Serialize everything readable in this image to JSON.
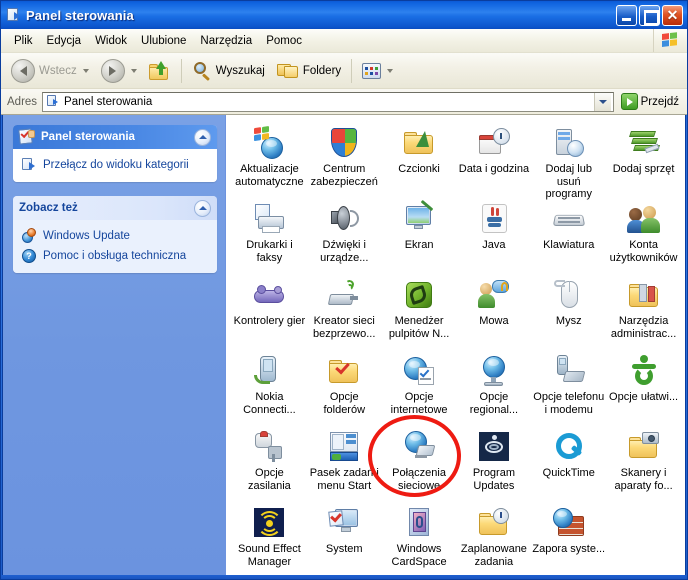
{
  "window": {
    "title": "Panel sterowania",
    "title_icon": "control-panel-icon",
    "buttons": {
      "minimize": "_",
      "maximize": "□",
      "close": "✕"
    }
  },
  "menubar": {
    "items": [
      {
        "label": "Plik"
      },
      {
        "label": "Edycja"
      },
      {
        "label": "Widok"
      },
      {
        "label": "Ulubione"
      },
      {
        "label": "Narzędzia"
      },
      {
        "label": "Pomoc"
      }
    ],
    "brand_icon": "windows-flag-icon"
  },
  "toolbar": {
    "back_label": "Wstecz",
    "forward_label": "",
    "up_label": "",
    "search_label": "Wyszukaj",
    "folders_label": "Foldery",
    "views_label": ""
  },
  "addressbar": {
    "label": "Adres",
    "value": "Panel sterowania",
    "placeholder": "Panel sterowania",
    "go_label": "Przejdź"
  },
  "sidebar": {
    "panels": [
      {
        "title": "Panel sterowania",
        "style": "blue",
        "icon": "control-panel-icon",
        "links": [
          {
            "label": "Przełącz do widoku kategorii",
            "icon": "switch-view-icon"
          }
        ]
      },
      {
        "title": "Zobacz też",
        "style": "light",
        "icon": "",
        "links": [
          {
            "label": "Windows Update",
            "icon": "windows-update-icon"
          },
          {
            "label": "Pomoc i obsługa techniczna",
            "icon": "help-icon"
          }
        ]
      }
    ]
  },
  "content": {
    "items": [
      {
        "label": "Aktualizacje automatyczne",
        "icon": "automatic-updates-icon"
      },
      {
        "label": "Centrum zabezpieczeń",
        "icon": "security-center-icon"
      },
      {
        "label": "Czcionki",
        "icon": "fonts-folder-icon"
      },
      {
        "label": "Data i godzina",
        "icon": "date-time-icon"
      },
      {
        "label": "Dodaj lub usuń programy",
        "icon": "add-remove-programs-icon"
      },
      {
        "label": "Dodaj sprzęt",
        "icon": "add-hardware-icon"
      },
      {
        "label": "Drukarki i faksy",
        "icon": "printers-faxes-icon"
      },
      {
        "label": "Dźwięki i urządze...",
        "icon": "sounds-audio-icon"
      },
      {
        "label": "Ekran",
        "icon": "display-icon"
      },
      {
        "label": "Java",
        "icon": "java-icon"
      },
      {
        "label": "Klawiatura",
        "icon": "keyboard-icon"
      },
      {
        "label": "Konta użytkowników",
        "icon": "user-accounts-icon"
      },
      {
        "label": "Kontrolery gier",
        "icon": "game-controllers-icon"
      },
      {
        "label": "Kreator sieci bezprzewo...",
        "icon": "wireless-network-wizard-icon"
      },
      {
        "label": "Menedżer pulpitów N...",
        "icon": "nvidia-desktop-manager-icon"
      },
      {
        "label": "Mowa",
        "icon": "speech-icon"
      },
      {
        "label": "Mysz",
        "icon": "mouse-icon"
      },
      {
        "label": "Narzędzia administrac...",
        "icon": "administrative-tools-icon"
      },
      {
        "label": "Nokia Connecti...",
        "icon": "nokia-connectivity-icon"
      },
      {
        "label": "Opcje folderów",
        "icon": "folder-options-icon"
      },
      {
        "label": "Opcje internetowe",
        "icon": "internet-options-icon"
      },
      {
        "label": "Opcje regional...",
        "icon": "regional-options-icon"
      },
      {
        "label": "Opcje telefonu i modemu",
        "icon": "phone-modem-options-icon"
      },
      {
        "label": "Opcje ułatwi...",
        "icon": "accessibility-options-icon"
      },
      {
        "label": "Opcje zasilania",
        "icon": "power-options-icon"
      },
      {
        "label": "Pasek zadań i menu Start",
        "icon": "taskbar-start-menu-icon"
      },
      {
        "label": "Połączenia sieciowe",
        "icon": "network-connections-icon"
      },
      {
        "label": "Program Updates",
        "icon": "program-updates-icon"
      },
      {
        "label": "QuickTime",
        "icon": "quicktime-icon"
      },
      {
        "label": "Skanery i aparaty fo...",
        "icon": "scanners-cameras-icon"
      },
      {
        "label": "Sound Effect Manager",
        "icon": "sound-effect-manager-icon"
      },
      {
        "label": "System",
        "icon": "system-icon"
      },
      {
        "label": "Windows CardSpace",
        "icon": "windows-cardspace-icon"
      },
      {
        "label": "Zaplanowane zadania",
        "icon": "scheduled-tasks-icon"
      },
      {
        "label": "Zapora syste...",
        "icon": "windows-firewall-icon"
      }
    ]
  },
  "annotation": {
    "shape": "ellipse",
    "color": "#ee1b12",
    "targets_item": "Połączenia sieciowe"
  },
  "colors": {
    "titlebar_blue": "#1064e0",
    "sidebar_blue": "#6f97e0",
    "panel_header_blue": "#4a88e4",
    "link_blue": "#14459c",
    "annotation_red": "#ee1b12"
  }
}
